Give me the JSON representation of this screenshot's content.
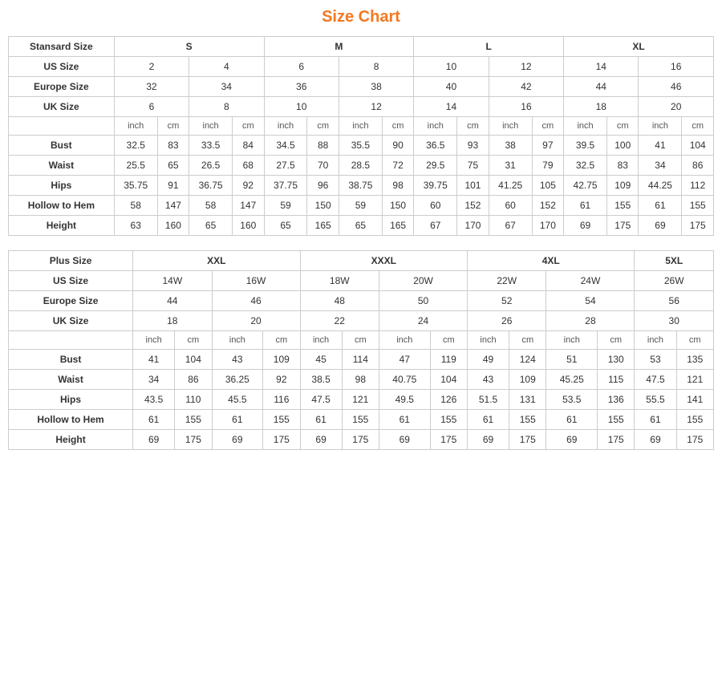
{
  "title": "Size Chart",
  "standard": {
    "headers": {
      "col1": "Stansard Size",
      "s": "S",
      "m": "M",
      "l": "L",
      "xl": "XL"
    },
    "us_size": {
      "label": "US Size",
      "values": [
        "2",
        "4",
        "6",
        "8",
        "10",
        "12",
        "14",
        "16"
      ]
    },
    "europe_size": {
      "label": "Europe Size",
      "values": [
        "32",
        "34",
        "36",
        "38",
        "40",
        "42",
        "44",
        "46"
      ]
    },
    "uk_size": {
      "label": "UK Size",
      "values": [
        "6",
        "8",
        "10",
        "12",
        "14",
        "16",
        "18",
        "20"
      ]
    },
    "units": [
      "inch",
      "cm",
      "inch",
      "cm",
      "inch",
      "cm",
      "inch",
      "cm",
      "inch",
      "cm",
      "inch",
      "cm",
      "inch",
      "cm",
      "inch",
      "cm"
    ],
    "bust": {
      "label": "Bust",
      "values": [
        "32.5",
        "83",
        "33.5",
        "84",
        "34.5",
        "88",
        "35.5",
        "90",
        "36.5",
        "93",
        "38",
        "97",
        "39.5",
        "100",
        "41",
        "104"
      ]
    },
    "waist": {
      "label": "Waist",
      "values": [
        "25.5",
        "65",
        "26.5",
        "68",
        "27.5",
        "70",
        "28.5",
        "72",
        "29.5",
        "75",
        "31",
        "79",
        "32.5",
        "83",
        "34",
        "86"
      ]
    },
    "hips": {
      "label": "Hips",
      "values": [
        "35.75",
        "91",
        "36.75",
        "92",
        "37.75",
        "96",
        "38.75",
        "98",
        "39.75",
        "101",
        "41.25",
        "105",
        "42.75",
        "109",
        "44.25",
        "112"
      ]
    },
    "hollow": {
      "label": "Hollow to Hem",
      "values": [
        "58",
        "147",
        "58",
        "147",
        "59",
        "150",
        "59",
        "150",
        "60",
        "152",
        "60",
        "152",
        "61",
        "155",
        "61",
        "155"
      ]
    },
    "height": {
      "label": "Height",
      "values": [
        "63",
        "160",
        "65",
        "160",
        "65",
        "165",
        "65",
        "165",
        "67",
        "170",
        "67",
        "170",
        "69",
        "175",
        "69",
        "175"
      ]
    }
  },
  "plus": {
    "headers": {
      "col1": "Plus Size",
      "xxl": "XXL",
      "xxxl": "XXXL",
      "4xl": "4XL",
      "5xl": "5XL"
    },
    "us_size": {
      "label": "US Size",
      "values": [
        "14W",
        "16W",
        "18W",
        "20W",
        "22W",
        "24W",
        "26W"
      ]
    },
    "europe_size": {
      "label": "Europe Size",
      "values": [
        "44",
        "46",
        "48",
        "50",
        "52",
        "54",
        "56"
      ]
    },
    "uk_size": {
      "label": "UK Size",
      "values": [
        "18",
        "20",
        "22",
        "24",
        "26",
        "28",
        "30"
      ]
    },
    "units": [
      "inch",
      "cm",
      "inch",
      "cm",
      "inch",
      "cm",
      "inch",
      "cm",
      "inch",
      "cm",
      "inch",
      "cm",
      "inch",
      "cm"
    ],
    "bust": {
      "label": "Bust",
      "values": [
        "41",
        "104",
        "43",
        "109",
        "45",
        "114",
        "47",
        "119",
        "49",
        "124",
        "51",
        "130",
        "53",
        "135"
      ]
    },
    "waist": {
      "label": "Waist",
      "values": [
        "34",
        "86",
        "36.25",
        "92",
        "38.5",
        "98",
        "40.75",
        "104",
        "43",
        "109",
        "45.25",
        "115",
        "47.5",
        "121"
      ]
    },
    "hips": {
      "label": "Hips",
      "values": [
        "43.5",
        "110",
        "45.5",
        "116",
        "47.5",
        "121",
        "49.5",
        "126",
        "51.5",
        "131",
        "53.5",
        "136",
        "55.5",
        "141"
      ]
    },
    "hollow": {
      "label": "Hollow to Hem",
      "values": [
        "61",
        "155",
        "61",
        "155",
        "61",
        "155",
        "61",
        "155",
        "61",
        "155",
        "61",
        "155",
        "61",
        "155"
      ]
    },
    "height": {
      "label": "Height",
      "values": [
        "69",
        "175",
        "69",
        "175",
        "69",
        "175",
        "69",
        "175",
        "69",
        "175",
        "69",
        "175",
        "69",
        "175"
      ]
    }
  }
}
